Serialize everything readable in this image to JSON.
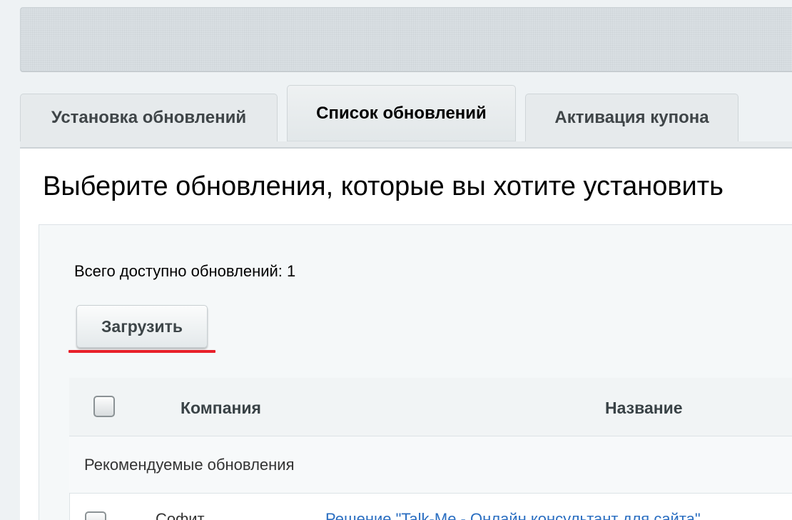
{
  "tabs": [
    {
      "label": "Установка обновлений",
      "active": false
    },
    {
      "label": "Список обновлений",
      "active": true
    },
    {
      "label": "Активация купона",
      "active": false
    }
  ],
  "main": {
    "heading": "Выберите обновления, которые вы хотите установить",
    "total_text": "Всего доступно обновлений: 1",
    "load_button_label": "Загрузить"
  },
  "table": {
    "columns": [
      "Компания",
      "Название"
    ],
    "group_label": "Рекомендуемые обновления",
    "rows": [
      {
        "company": "Софит",
        "title": "Решение \"Talk-Me - Онлайн консультант для сайта\""
      }
    ]
  },
  "colors": {
    "accent_underline": "#e8202a",
    "link": "#2a6ec1"
  }
}
